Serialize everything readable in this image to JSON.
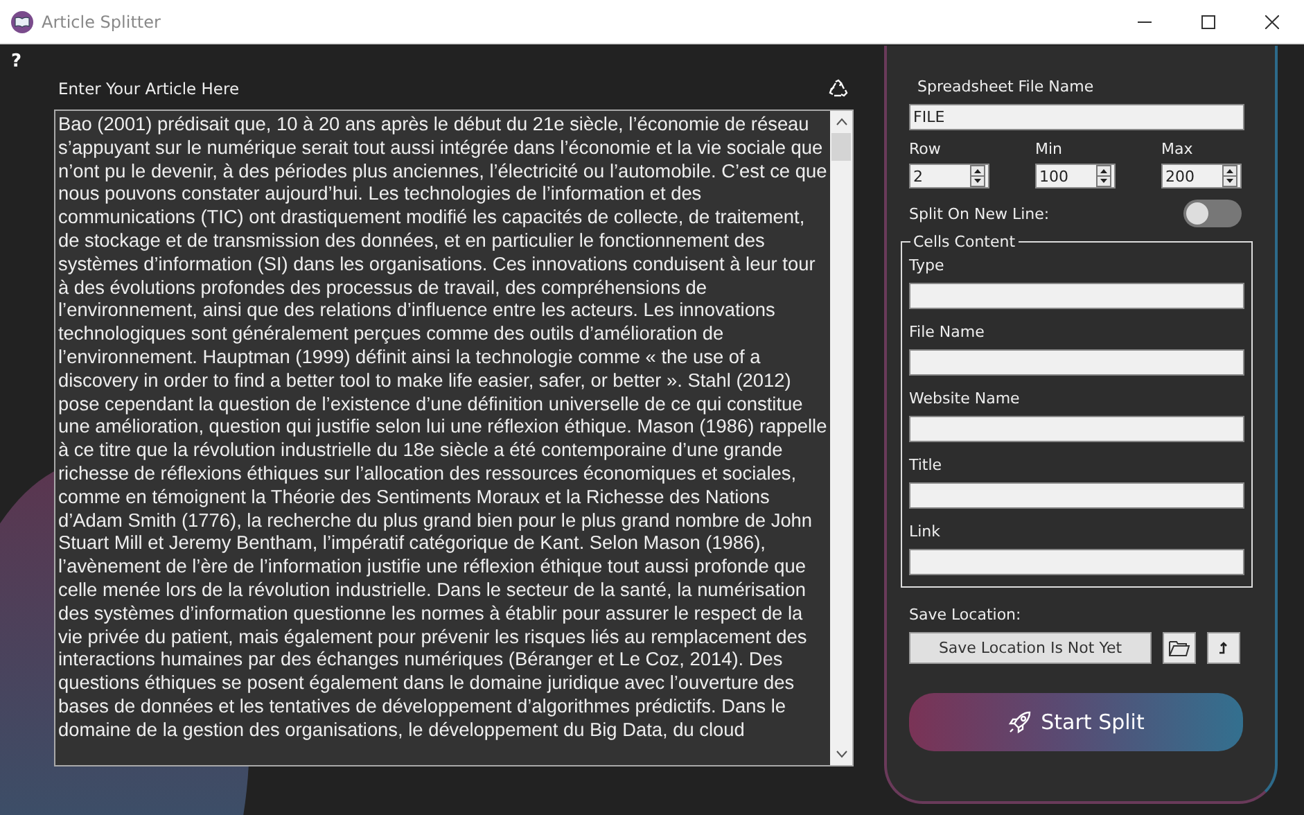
{
  "window": {
    "title": "Article Splitter"
  },
  "help": "?",
  "article": {
    "label": "Enter Your Article Here",
    "text": "Bao (2001) prédisait que, 10 à 20 ans après le début du 21e siècle, l’économie de réseau s’appuyant sur le numérique serait tout aussi intégrée dans l’économie et la vie sociale que n’ont pu le devenir, à des périodes plus anciennes, l’électricité ou l’automobile. C’est ce que nous pouvons constater aujourd’hui. Les technologies de l’information et des communications (TIC) ont drastiquement modifié les capacités de collecte, de traitement, de stockage et de transmission des données, et en particulier le fonctionnement des systèmes d’information (SI) dans les organisations. Ces innovations conduisent à leur tour à des évolutions profondes des processus de travail, des compréhensions de l’environnement, ainsi que des relations d’influence entre les acteurs. Les innovations technologiques sont généralement perçues comme des outils d’amélioration de l’environnement. Hauptman (1999) définit ainsi la technologie comme « the use of a discovery in order to find a better tool to make life easier, safer, or better ». Stahl (2012) pose cependant la question de l’existence d’une définition universelle de ce qui constitue une amélioration, question qui justifie selon lui une réflexion éthique. Mason (1986) rappelle à ce titre que la révolution industrielle du 18e siècle a été contemporaine d’une grande richesse de réflexions éthiques sur l’allocation des ressources économiques et sociales, comme en témoignent la Théorie des Sentiments Moraux et la Richesse des Nations d’Adam Smith (1776), la recherche du plus grand bien pour le plus grand nombre de John Stuart Mill et Jeremy Bentham, l’impératif catégorique de Kant. Selon Mason (1986), l’avènement de l’ère de l’information justifie une réflexion éthique tout aussi profonde que celle menée lors de la révolution industrielle. Dans le secteur de la santé, la numérisation des systèmes d’information questionne les normes à établir pour assurer le respect de la vie privée du patient, mais également pour prévenir les risques liés au remplacement des interactions humaines par des échanges numériques (Béranger et Le Coz, 2014). Des questions éthiques se posent également dans le domaine juridique avec l’ouverture des bases de données et les tentatives de développement d’algorithmes prédictifs. Dans le domaine de la gestion des organisations, le développement du Big Data, du cloud"
  },
  "settings": {
    "file_label": "Spreadsheet File Name",
    "file_value": "FILE",
    "spinners": [
      {
        "label": "Row",
        "value": "2"
      },
      {
        "label": "Min",
        "value": "100"
      },
      {
        "label": "Max",
        "value": "200"
      }
    ],
    "split_label": "Split On New Line:",
    "split_on": false,
    "group": {
      "title": "Cells Content",
      "fields": [
        {
          "label": "Type"
        },
        {
          "label": "File Name"
        },
        {
          "label": "Website Name"
        },
        {
          "label": "Title"
        },
        {
          "label": "Link"
        }
      ]
    },
    "save_label": "Save Location:",
    "save_button": "Save Location Is Not Yet",
    "start_button": "Start Split"
  }
}
